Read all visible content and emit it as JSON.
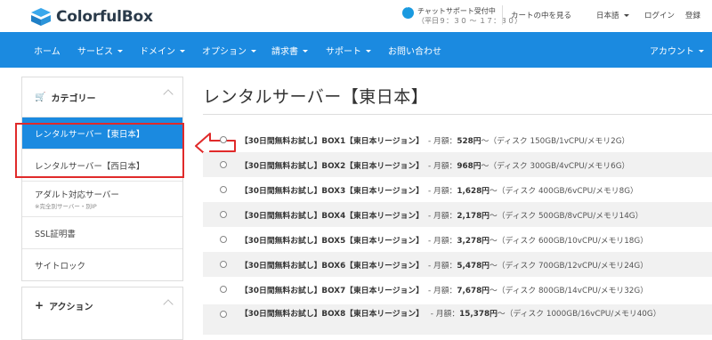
{
  "brand": {
    "name": "ColorfulBox"
  },
  "support": {
    "title": "チャットサポート受付中",
    "hours": "（平日９：３０ ～ １７：３０）"
  },
  "top_links": {
    "cart": "カートの中を見る",
    "language": "日本語",
    "login": "ログイン",
    "register": "登録"
  },
  "nav": {
    "items": [
      {
        "label": "ホーム",
        "dropdown": false
      },
      {
        "label": "サービス",
        "dropdown": true
      },
      {
        "label": "ドメイン",
        "dropdown": true
      },
      {
        "label": "オプション",
        "dropdown": true
      },
      {
        "label": "請求書",
        "dropdown": true
      },
      {
        "label": "サポート",
        "dropdown": true
      },
      {
        "label": "お問い合わせ",
        "dropdown": false
      }
    ],
    "account": "アカウント"
  },
  "sidebar": {
    "categories_title": "カテゴリー",
    "categories": [
      {
        "label": "レンタルサーバー【東日本】",
        "active": true
      },
      {
        "label": "レンタルサーバー【西日本】",
        "active": false
      },
      {
        "label": "アダルト対応サーバー",
        "sub": "※完全別サーバー・別IP",
        "active": false
      },
      {
        "label": "SSL証明書",
        "active": false
      },
      {
        "label": "サイトロック",
        "active": false
      }
    ],
    "actions_title": "アクション"
  },
  "page": {
    "title": "レンタルサーバー【東日本】"
  },
  "products": [
    {
      "name": "【30日間無料お試し】BOX1【東日本リージョン】",
      "meta": "- 月額：",
      "price": "528円",
      "spec": "～（ディスク 150GB/1vCPU/メモリ2G）"
    },
    {
      "name": "【30日間無料お試し】BOX2【東日本リージョン】",
      "meta": "- 月額：",
      "price": "968円",
      "spec": "～（ディスク 300GB/4vCPU/メモリ6G）"
    },
    {
      "name": "【30日間無料お試し】BOX3【東日本リージョン】",
      "meta": "- 月額：",
      "price": "1,628円",
      "spec": "～（ディスク 400GB/6vCPU/メモリ8G）"
    },
    {
      "name": "【30日間無料お試し】BOX4【東日本リージョン】",
      "meta": "- 月額：",
      "price": "2,178円",
      "spec": "～（ディスク 500GB/8vCPU/メモリ14G）"
    },
    {
      "name": "【30日間無料お試し】BOX5【東日本リージョン】",
      "meta": "- 月額：",
      "price": "3,278円",
      "spec": "～（ディスク 600GB/10vCPU/メモリ18G）"
    },
    {
      "name": "【30日間無料お試し】BOX6【東日本リージョン】",
      "meta": "- 月額：",
      "price": "5,478円",
      "spec": "～（ディスク 700GB/12vCPU/メモリ24G）"
    },
    {
      "name": "【30日間無料お試し】BOX7【東日本リージョン】",
      "meta": "- 月額：",
      "price": "7,678円",
      "spec": "～（ディスク 800GB/14vCPU/メモリ32G）"
    },
    {
      "name": "【30日間無料お試し】BOX8【東日本リージョン】",
      "meta": "- 月額：",
      "price": "15,378円",
      "spec": "～（ディスク 1000GB/16vCPU/メモリ40G）"
    }
  ],
  "colors": {
    "brand_blue": "#1b8ae0",
    "highlight_red": "#e02a2a"
  }
}
